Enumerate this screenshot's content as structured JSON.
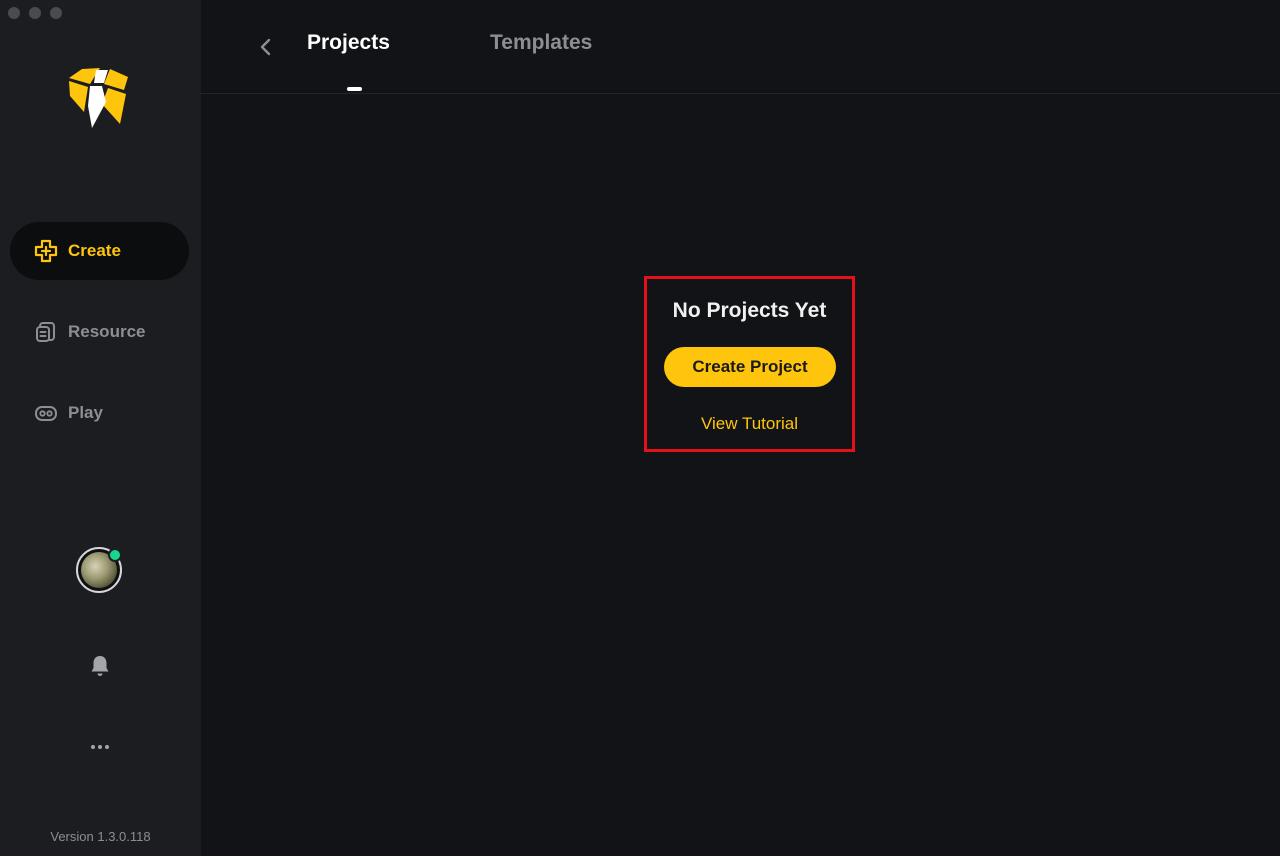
{
  "window": {
    "traffic_lights": [
      "close",
      "minimize",
      "zoom"
    ]
  },
  "sidebar": {
    "logo_icon": "app-logo-icon",
    "items": [
      {
        "label": "Create",
        "icon": "create-plus-icon",
        "active": true
      },
      {
        "label": "Resource",
        "icon": "resource-icon",
        "active": false
      },
      {
        "label": "Play",
        "icon": "gamepad-icon",
        "active": false
      }
    ],
    "avatar_status": "online",
    "notifications_icon": "bell-icon",
    "more_icon": "more-dots-icon",
    "version": "Version 1.3.0.118"
  },
  "header": {
    "back_icon": "chevron-left-icon",
    "tabs": [
      {
        "label": "Projects",
        "active": true
      },
      {
        "label": "Templates",
        "active": false
      }
    ]
  },
  "empty_state": {
    "title": "No Projects Yet",
    "create_button": "Create Project",
    "tutorial_link": "View Tutorial"
  },
  "colors": {
    "accent": "#ffc40c",
    "sidebar_bg": "#1c1d21",
    "main_bg": "#121316",
    "highlight_border": "#e3121a",
    "status_online": "#19d68f"
  }
}
